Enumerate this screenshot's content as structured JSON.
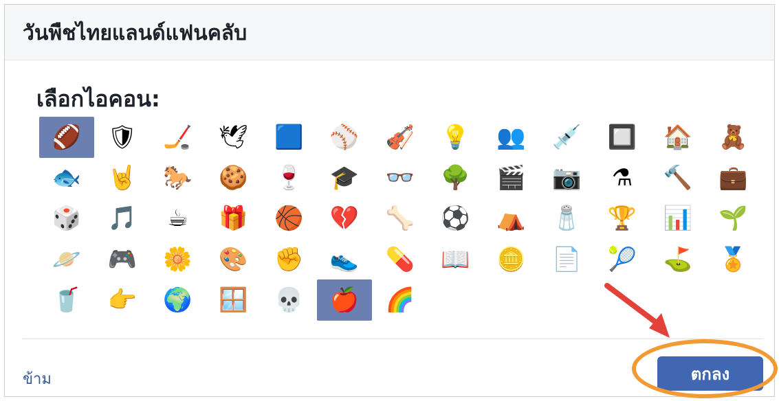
{
  "dialog": {
    "title": "วันพืชไทยแลนด์แฟนคลับ",
    "prompt": "เลือกไอคอน:",
    "skip_label": "ข้าม",
    "ok_label": "ตกลง"
  },
  "icons": [
    [
      "american-football-icon",
      "🏈"
    ],
    [
      "shield-icon",
      "🛡"
    ],
    [
      "hockey-puck-icon",
      "🏒"
    ],
    [
      "dove-icon",
      "🕊"
    ],
    [
      "blue-square-icon",
      "🟦"
    ],
    [
      "baseball-icon",
      "⚾"
    ],
    [
      "violin-icon",
      "🎻"
    ],
    [
      "lightbulb-icon",
      "💡"
    ],
    [
      "group-icon",
      "👥"
    ],
    [
      "syringe-icon",
      "💉"
    ],
    [
      "chip-icon",
      "🔲"
    ],
    [
      "house-icon",
      "🏠"
    ],
    [
      "teddy-bear-icon",
      "🧸"
    ],
    [
      "fish-icon",
      "🐟"
    ],
    [
      "rock-hand-icon",
      "🤘"
    ],
    [
      "horse-icon",
      "🐎"
    ],
    [
      "cookie-icon",
      "🍪"
    ],
    [
      "wine-glass-icon",
      "🍷"
    ],
    [
      "graduation-cap-icon",
      "🎓"
    ],
    [
      "glasses-icon",
      "👓"
    ],
    [
      "tree-icon",
      "🌳"
    ],
    [
      "clapperboard-icon",
      "🎬"
    ],
    [
      "camera-icon",
      "📷"
    ],
    [
      "flask-icon",
      "⚗"
    ],
    [
      "gavel-icon",
      "🔨"
    ],
    [
      "briefcase-icon",
      "💼"
    ],
    [
      "dice-icon",
      "🎲"
    ],
    [
      "music-note-icon",
      "🎵"
    ],
    [
      "coffee-icon",
      "☕"
    ],
    [
      "gift-icon",
      "🎁"
    ],
    [
      "basketball-icon",
      "🏀"
    ],
    [
      "broken-heart-icon",
      "💔"
    ],
    [
      "bone-icon",
      "🦴"
    ],
    [
      "soccer-ball-icon",
      "⚽"
    ],
    [
      "tent-night-icon",
      "⛺"
    ],
    [
      "salt-shaker-icon",
      "🧂"
    ],
    [
      "trophy-icon",
      "🏆"
    ],
    [
      "pie-chart-icon",
      "📊"
    ],
    [
      "plant-icon",
      "🌱"
    ],
    [
      "planet-icon",
      "🪐"
    ],
    [
      "game-controller-icon",
      "🎮"
    ],
    [
      "flower-icon",
      "🌼"
    ],
    [
      "palette-icon",
      "🎨"
    ],
    [
      "fist-icon",
      "✊"
    ],
    [
      "sneaker-icon",
      "👟"
    ],
    [
      "pills-icon",
      "💊"
    ],
    [
      "book-icon",
      "📖"
    ],
    [
      "coin-icon",
      "🪙"
    ],
    [
      "document-icon",
      "📄"
    ],
    [
      "tennis-racket-icon",
      "🎾"
    ],
    [
      "golf-icon",
      "⛳"
    ],
    [
      "badge-icon",
      "🏅"
    ],
    [
      "red-cup-icon",
      "🥤"
    ],
    [
      "pointing-hand-icon",
      "👉"
    ],
    [
      "globe-icon",
      "🌍"
    ],
    [
      "grid-window-icon",
      "🪟"
    ],
    [
      "skull-icon",
      "💀"
    ],
    [
      "apple-icon",
      "🍎"
    ],
    [
      "rainbow-icon",
      "🌈"
    ]
  ],
  "selected_indices": [
    0,
    57
  ],
  "colors": {
    "accent": "#4267b2",
    "selected": "#6b7fb0",
    "highlight": "#f29a33",
    "arrow": "#e2423a"
  }
}
